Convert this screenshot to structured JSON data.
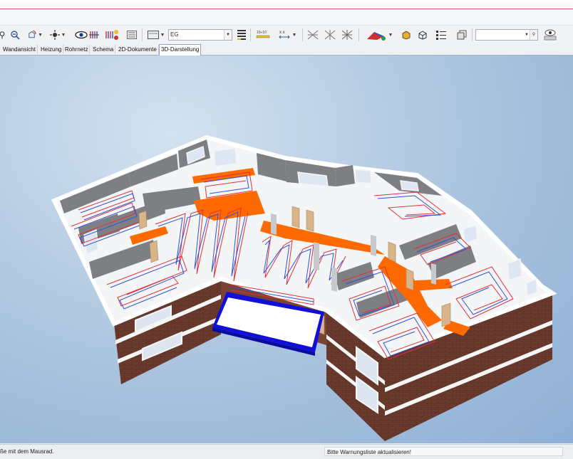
{
  "toolbar": {
    "floor_combo_value": "EG",
    "search_value": ""
  },
  "tabs": [
    {
      "label": "Wandansicht"
    },
    {
      "label": "Heizung"
    },
    {
      "label": "Rohrnetz"
    },
    {
      "label": "Schema"
    },
    {
      "label": "2D-Dokumente"
    },
    {
      "label": "3D-Darstellung"
    }
  ],
  "status": {
    "left_text": "ße mit dem Mausrad.",
    "right_text": "Bitte Warnungsliste aktualisieren!"
  },
  "colors": {
    "pipe_red": "#e0303a",
    "pipe_blue": "#3050d8",
    "distribution_orange": "#ff6a00",
    "balcony_blue": "#1010d8",
    "brick": "#6a3a2c"
  }
}
